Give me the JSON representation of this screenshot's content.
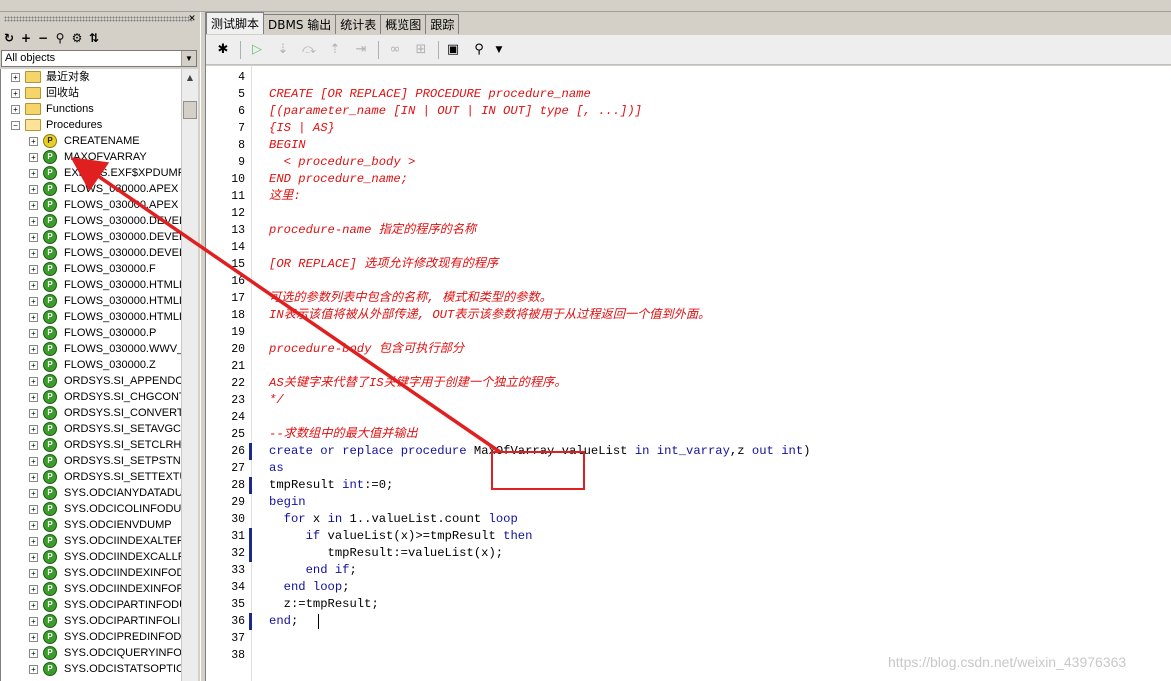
{
  "left_panel": {
    "filter": "All objects",
    "tree": [
      {
        "type": "folder",
        "label": "最近对象"
      },
      {
        "type": "folder",
        "label": "回收站"
      },
      {
        "type": "folder",
        "label": "Functions"
      },
      {
        "type": "folder-open",
        "label": "Procedures"
      },
      {
        "type": "proc-invalid",
        "label": "CREATENAME"
      },
      {
        "type": "proc",
        "label": "MAXOFVARRAY"
      },
      {
        "type": "proc",
        "label": "EXFSYS.EXF$XPDUMP"
      },
      {
        "type": "proc",
        "label": "FLOWS_030000.APEX"
      },
      {
        "type": "proc",
        "label": "FLOWS_030000.APEX"
      },
      {
        "type": "proc",
        "label": "FLOWS_030000.DEVEL"
      },
      {
        "type": "proc",
        "label": "FLOWS_030000.DEVEL"
      },
      {
        "type": "proc",
        "label": "FLOWS_030000.DEVEL"
      },
      {
        "type": "proc",
        "label": "FLOWS_030000.F"
      },
      {
        "type": "proc",
        "label": "FLOWS_030000.HTMLI"
      },
      {
        "type": "proc",
        "label": "FLOWS_030000.HTMLI"
      },
      {
        "type": "proc",
        "label": "FLOWS_030000.HTMLI"
      },
      {
        "type": "proc",
        "label": "FLOWS_030000.P"
      },
      {
        "type": "proc",
        "label": "FLOWS_030000.WWV_"
      },
      {
        "type": "proc",
        "label": "FLOWS_030000.Z"
      },
      {
        "type": "proc",
        "label": "ORDSYS.SI_APPENDC"
      },
      {
        "type": "proc",
        "label": "ORDSYS.SI_CHGCONT"
      },
      {
        "type": "proc",
        "label": "ORDSYS.SI_CONVERT"
      },
      {
        "type": "proc",
        "label": "ORDSYS.SI_SETAVGC"
      },
      {
        "type": "proc",
        "label": "ORDSYS.SI_SETCLRH"
      },
      {
        "type": "proc",
        "label": "ORDSYS.SI_SETPSTN"
      },
      {
        "type": "proc",
        "label": "ORDSYS.SI_SETTEXTU"
      },
      {
        "type": "proc",
        "label": "SYS.ODCIANYDATADU"
      },
      {
        "type": "proc",
        "label": "SYS.ODCICOLINFODUI"
      },
      {
        "type": "proc",
        "label": "SYS.ODCIENVDUMP"
      },
      {
        "type": "proc",
        "label": "SYS.ODCIINDEXALTEF"
      },
      {
        "type": "proc",
        "label": "SYS.ODCIINDEXCALLP"
      },
      {
        "type": "proc",
        "label": "SYS.ODCIINDEXINFOD"
      },
      {
        "type": "proc",
        "label": "SYS.ODCIINDEXINFOF"
      },
      {
        "type": "proc",
        "label": "SYS.ODCIPARTINFODU"
      },
      {
        "type": "proc",
        "label": "SYS.ODCIPARTINFOLIS"
      },
      {
        "type": "proc",
        "label": "SYS.ODCIPREDINFODU"
      },
      {
        "type": "proc",
        "label": "SYS.ODCIQUERYINFOI"
      },
      {
        "type": "proc",
        "label": "SYS.ODCISTATSOPTIC"
      }
    ]
  },
  "tabs": [
    "测试脚本",
    "DBMS 输出",
    "统计表",
    "概览图",
    "跟踪"
  ],
  "editor": {
    "lines": [
      {
        "n": "4",
        "text": "",
        "style": "plain"
      },
      {
        "n": "5",
        "text": "CREATE [OR REPLACE] PROCEDURE procedure_name",
        "style": "comment"
      },
      {
        "n": "6",
        "text": "[(parameter_name [IN | OUT | IN OUT] type [, ...])]",
        "style": "comment"
      },
      {
        "n": "7",
        "text": "{IS | AS}",
        "style": "comment"
      },
      {
        "n": "8",
        "text": "BEGIN",
        "style": "comment"
      },
      {
        "n": "9",
        "text": "  < procedure_body >",
        "style": "comment"
      },
      {
        "n": "10",
        "text": "END procedure_name;",
        "style": "comment"
      },
      {
        "n": "11",
        "text": "这里:",
        "style": "comment"
      },
      {
        "n": "12",
        "text": "",
        "style": "plain"
      },
      {
        "n": "13",
        "text": "procedure-name 指定的程序的名称",
        "style": "comment"
      },
      {
        "n": "14",
        "text": "",
        "style": "plain"
      },
      {
        "n": "15",
        "text": "[OR REPLACE] 选项允许修改现有的程序",
        "style": "comment"
      },
      {
        "n": "16",
        "text": "",
        "style": "plain"
      },
      {
        "n": "17",
        "text": "可选的参数列表中包含的名称, 模式和类型的参数。",
        "style": "comment"
      },
      {
        "n": "18",
        "text": "IN表示该值将被从外部传递, OUT表示该参数将被用于从过程返回一个值到外面。",
        "style": "comment"
      },
      {
        "n": "19",
        "text": "",
        "style": "plain"
      },
      {
        "n": "20",
        "text": "procedure-body 包含可执行部分",
        "style": "comment"
      },
      {
        "n": "21",
        "text": "",
        "style": "plain"
      },
      {
        "n": "22",
        "text": "AS关键字来代替了IS关键字用于创建一个独立的程序。",
        "style": "comment"
      },
      {
        "n": "23",
        "text": "*/",
        "style": "comment"
      },
      {
        "n": "24",
        "text": "",
        "style": "plain"
      },
      {
        "n": "25",
        "text": "--求数组中的最大值并输出",
        "style": "comment"
      },
      {
        "n": "26",
        "text": "create or replace procedure MaxOfVarray valueList in int_varray,z out int)",
        "style": "code"
      },
      {
        "n": "27",
        "text": "as",
        "style": "code"
      },
      {
        "n": "28",
        "text": "tmpResult int:=0;",
        "style": "code"
      },
      {
        "n": "29",
        "text": "begin",
        "style": "code"
      },
      {
        "n": "30",
        "text": "  for x in 1..valueList.count loop",
        "style": "code"
      },
      {
        "n": "31",
        "text": "     if valueList(x)>=tmpResult then",
        "style": "code"
      },
      {
        "n": "32",
        "text": "        tmpResult:=valueList(x);",
        "style": "code"
      },
      {
        "n": "33",
        "text": "     end if;",
        "style": "code"
      },
      {
        "n": "34",
        "text": "  end loop;",
        "style": "code"
      },
      {
        "n": "35",
        "text": "  z:=tmpResult;",
        "style": "code"
      },
      {
        "n": "36",
        "text": "end;",
        "style": "code"
      },
      {
        "n": "37",
        "text": "",
        "style": "plain"
      },
      {
        "n": "38",
        "text": "",
        "style": "plain"
      }
    ]
  },
  "watermark": "https://blog.csdn.net/weixin_43976363",
  "colors": {
    "comment": "#e01010",
    "keyword": "#1010a0",
    "annotation": "#e02020"
  }
}
